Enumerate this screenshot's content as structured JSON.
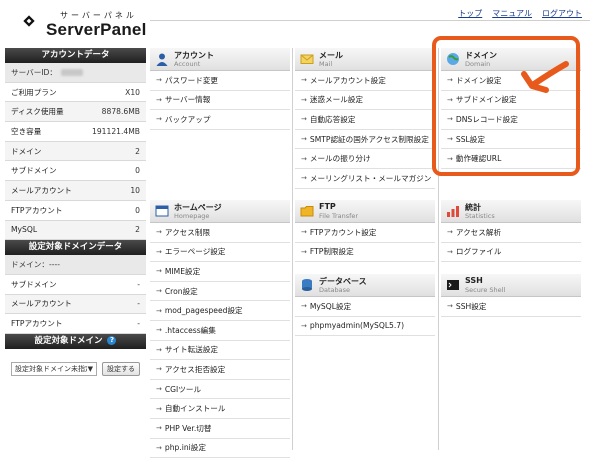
{
  "header": {
    "logo_kana": "サーバーパネル",
    "logo_name": "ServerPanel",
    "links": [
      "トップ",
      "マニュアル",
      "ログアウト"
    ]
  },
  "sidebar": {
    "account_title": "アカウントデータ",
    "server_id_label": "サーバーID：",
    "rows": [
      {
        "k": "ご利用プラン",
        "v": "X10"
      },
      {
        "k": "ディスク使用量",
        "v": "8878.6MB"
      },
      {
        "k": "空き容量",
        "v": "191121.4MB"
      },
      {
        "k": "ドメイン",
        "v": "2"
      },
      {
        "k": "サブドメイン",
        "v": "0"
      },
      {
        "k": "メールアカウント",
        "v": "10"
      },
      {
        "k": "FTPアカウント",
        "v": "0"
      },
      {
        "k": "MySQL",
        "v": "2"
      }
    ],
    "domain_data_title": "設定対象ドメインデータ",
    "domain_label": "ドメイン：----",
    "domain_rows": [
      {
        "k": "サブドメイン",
        "v": "-"
      },
      {
        "k": "メールアカウント",
        "v": "-"
      },
      {
        "k": "FTPアカウント",
        "v": "-"
      }
    ],
    "target_title": "設定対象ドメイン",
    "help_glyph": "?",
    "select_value": "設定対象ドメイン未指定",
    "set_button": "設定する"
  },
  "panels": {
    "account": {
      "title": "アカウント",
      "sub": "Account",
      "items": [
        "パスワード変更",
        "サーバー情報",
        "バックアップ"
      ]
    },
    "mail": {
      "title": "メール",
      "sub": "Mail",
      "items": [
        "メールアカウント設定",
        "迷惑メール設定",
        "自動応答設定",
        "SMTP認証の国外アクセス制限設定",
        "メールの振り分け",
        "メーリングリスト・メールマガジン"
      ]
    },
    "domain": {
      "title": "ドメイン",
      "sub": "Domain",
      "items": [
        "ドメイン設定",
        "サブドメイン設定",
        "DNSレコード設定",
        "SSL設定",
        "動作確認URL"
      ]
    },
    "homepage": {
      "title": "ホームページ",
      "sub": "Homepage",
      "items": [
        "アクセス制限",
        "エラーページ設定",
        "MIME設定",
        "Cron設定",
        "mod_pagespeed設定",
        ".htaccess編集",
        "サイト転送設定",
        "アクセス拒否設定",
        "CGIツール",
        "自動インストール",
        "PHP Ver.切替",
        "php.ini設定"
      ]
    },
    "ftp": {
      "title": "FTP",
      "sub": "File Transfer",
      "items": [
        "FTPアカウント設定",
        "FTP制限設定"
      ]
    },
    "stats": {
      "title": "統計",
      "sub": "Statistics",
      "items": [
        "アクセス解析",
        "ログファイル"
      ]
    },
    "database": {
      "title": "データベース",
      "sub": "Database",
      "items": [
        "MySQL設定",
        "phpmyadmin(MySQL5.7)"
      ]
    },
    "ssh": {
      "title": "SSH",
      "sub": "Secure Shell",
      "items": [
        "SSH設定"
      ]
    }
  },
  "colors": {
    "highlight": "#e85a1c",
    "link": "#1a3c8c",
    "sidebar_header": "#2a2a2a"
  }
}
